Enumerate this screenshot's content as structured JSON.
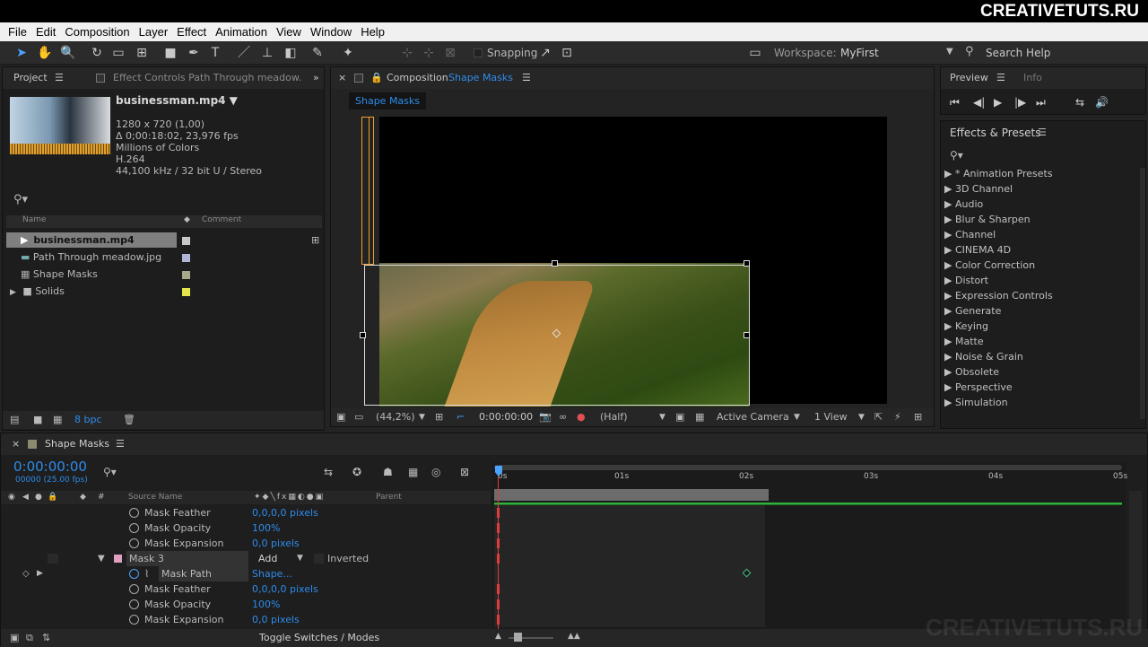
{
  "brand": "CREATIVETUTS.RU",
  "watermark": "CREATIVETUTS.RU",
  "menu": [
    "File",
    "Edit",
    "Composition",
    "Layer",
    "Effect",
    "Animation",
    "View",
    "Window",
    "Help"
  ],
  "toolbar": {
    "snapping": "Snapping",
    "workspace_label": "Workspace:",
    "workspace_value": "MyFirst",
    "search_help": "Search Help"
  },
  "project": {
    "tab": "Project",
    "effect_controls_tab": "Effect Controls Path Through meadow.",
    "file_name": "businessman.mp4 ▼",
    "file_info": [
      "1280 x 720 (1,00)",
      "Δ 0;00:18:02, 23,976 fps",
      "Millions of Colors",
      "H.264",
      "44,100 kHz / 32 bit U / Stereo"
    ],
    "col_name": "Name",
    "col_comment": "Comment",
    "items": [
      {
        "name": "businessman.mp4",
        "color": "#c8c8c8"
      },
      {
        "name": "Path Through meadow.jpg",
        "color": "#b0b4d8"
      },
      {
        "name": "Shape Masks",
        "color": "#a8a88c"
      },
      {
        "name": "Solids",
        "color": "#e4e44c"
      }
    ],
    "bpc": "8 bpc"
  },
  "comp": {
    "tab_prefix": "Composition",
    "tab_name": "Shape Masks",
    "flow_tab": "Shape Masks",
    "zoom": "(44,2%)",
    "time": "0:00:00:00",
    "resolution": "(Half)",
    "camera": "Active Camera",
    "views": "1 View"
  },
  "preview": {
    "tab": "Preview",
    "info_tab": "Info"
  },
  "effects": {
    "title": "Effects & Presets",
    "items": [
      "* Animation Presets",
      "3D Channel",
      "Audio",
      "Blur & Sharpen",
      "Channel",
      "CINEMA 4D",
      "Color Correction",
      "Distort",
      "Expression Controls",
      "Generate",
      "Keying",
      "Matte",
      "Noise & Grain",
      "Obsolete",
      "Perspective",
      "Simulation"
    ]
  },
  "timeline": {
    "tab": "Shape Masks",
    "timecode": "0:00:00:00",
    "frames": "00000 (25.00 fps)",
    "col_source": "Source Name",
    "col_parent": "Parent",
    "ruler": [
      "0s",
      "01s",
      "02s",
      "03s",
      "04s",
      "05s"
    ],
    "toggle": "Toggle Switches / Modes",
    "rows": [
      {
        "label": "Mask Feather",
        "value": "0,0,0,0 pixels"
      },
      {
        "label": "Mask Opacity",
        "value": "100%"
      },
      {
        "label": "Mask Expansion",
        "value": "0,0 pixels"
      },
      {
        "label": "Mask 3",
        "mode": "Add",
        "inverted": "Inverted"
      },
      {
        "label": "Mask Path",
        "value": "Shape..."
      },
      {
        "label": "Mask Feather",
        "value": "0,0,0,0 pixels"
      },
      {
        "label": "Mask Opacity",
        "value": "100%"
      },
      {
        "label": "Mask Expansion",
        "value": "0,0 pixels"
      }
    ]
  }
}
